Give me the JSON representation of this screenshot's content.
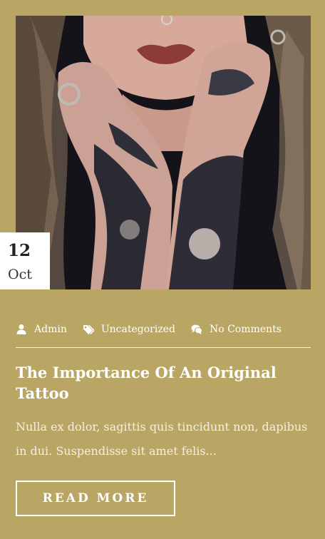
{
  "post": {
    "date": {
      "day": "12",
      "month": "Oct"
    },
    "meta": {
      "author": "Admin",
      "category": "Uncategorized",
      "comments": "No Comments"
    },
    "title": "The Importance Of An Original Tattoo",
    "excerpt": "Nulla ex dolor, sagittis quis tincidunt non, dapibus in dui. Suspendisse sit amet felis...",
    "read_more_label": "READ MORE"
  },
  "icons": {
    "author": "user-icon",
    "category": "tags-icon",
    "comments": "comments-icon"
  },
  "colors": {
    "background": "#b9a664",
    "text": "#ffffff",
    "badge": "#ffffff"
  }
}
